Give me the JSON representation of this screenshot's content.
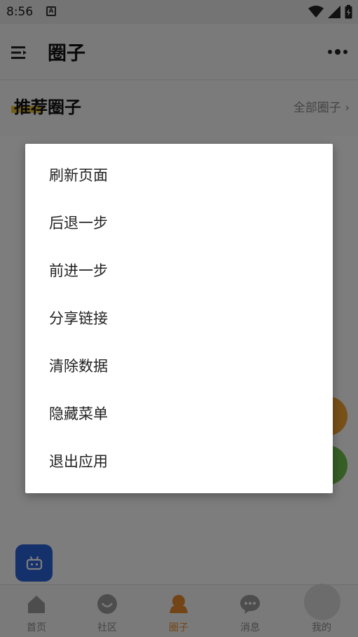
{
  "status": {
    "time": "8:56",
    "badge": "A"
  },
  "header": {
    "title": "圈子"
  },
  "section": {
    "title": "推荐圈子",
    "link": "全部圈子 ›"
  },
  "menu": {
    "items": [
      "刷新页面",
      "后退一步",
      "前进一步",
      "分享链接",
      "清除数据",
      "隐藏菜单",
      "退出应用"
    ]
  },
  "tabs": [
    {
      "label": "首页",
      "icon": "home-icon"
    },
    {
      "label": "社区",
      "icon": "community-icon"
    },
    {
      "label": "圈子",
      "icon": "circle-icon",
      "active": true
    },
    {
      "label": "消息",
      "icon": "message-icon"
    },
    {
      "label": "我的",
      "icon": "profile-icon"
    }
  ],
  "colors": {
    "accent": "#e6892b",
    "robot": "#2b62d9"
  }
}
